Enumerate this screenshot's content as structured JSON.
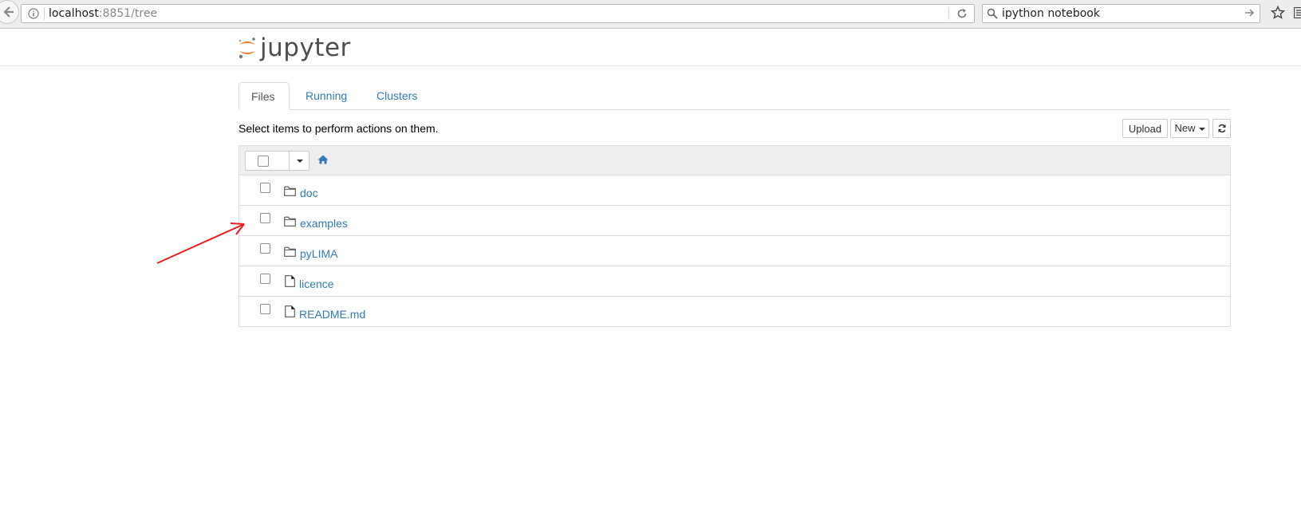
{
  "browser": {
    "url_host": "localhost",
    "url_rest": ":8851/tree",
    "search_query": "ipython notebook"
  },
  "header": {
    "logo_text": "jupyter",
    "logo_accent": "#f37626"
  },
  "tabs": [
    {
      "label": "Files",
      "active": true
    },
    {
      "label": "Running",
      "active": false
    },
    {
      "label": "Clusters",
      "active": false
    }
  ],
  "toolbar": {
    "instructions": "Select items to perform actions on them.",
    "upload_label": "Upload",
    "new_label": "New",
    "refresh_icon": "refresh-icon"
  },
  "file_list": {
    "items": [
      {
        "name": "doc",
        "type": "folder",
        "icon": "folder-icon"
      },
      {
        "name": "examples",
        "type": "folder",
        "icon": "folder-icon"
      },
      {
        "name": "pyLIMA",
        "type": "folder",
        "icon": "folder-icon"
      },
      {
        "name": "licence",
        "type": "file",
        "icon": "file-icon"
      },
      {
        "name": "README.md",
        "type": "file",
        "icon": "file-icon"
      }
    ]
  },
  "colors": {
    "link": "#337ab7",
    "annotation_arrow": "#ee1c1c"
  }
}
